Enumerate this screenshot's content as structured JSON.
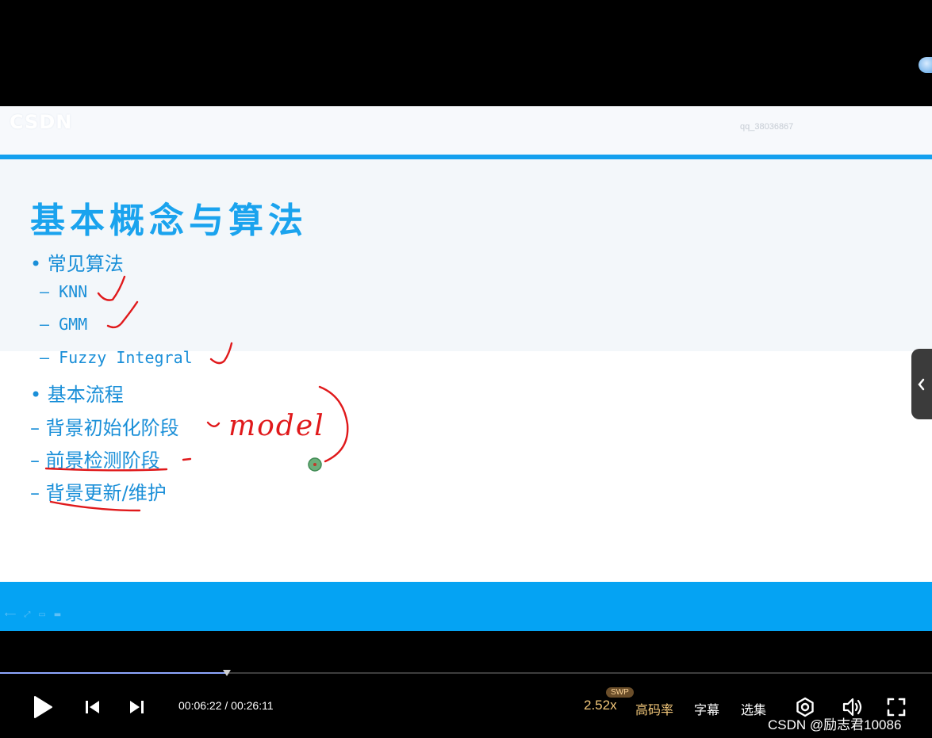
{
  "slide": {
    "logo": "CSDN",
    "user_watermark": "qq_38036867",
    "title": "基本概念与算法",
    "bullets": [
      {
        "marker": "•",
        "text": "常见算法"
      },
      {
        "marker": "–",
        "text": "KNN"
      },
      {
        "marker": "–",
        "text": "GMM"
      },
      {
        "marker": "–",
        "text": "Fuzzy Integral"
      },
      {
        "marker": "•",
        "text": "基本流程"
      },
      {
        "marker": "–",
        "text": "背景初始化阶段"
      },
      {
        "marker": "–",
        "text": "前景检测阶段"
      },
      {
        "marker": "–",
        "text": "背景更新/维护"
      }
    ],
    "handwritten_note": "model"
  },
  "player": {
    "current_time": "00:06:22",
    "total_time": "00:26:11",
    "progress_fraction": 0.243,
    "speed": "2.52x",
    "speed_badge": "SWP",
    "quality": "高码率",
    "subtitle": "字幕",
    "episodes": "选集",
    "icons": [
      "play-icon",
      "previous-icon",
      "next-icon",
      "settings-icon",
      "volume-icon",
      "fullscreen-icon",
      "chevron-left-icon"
    ]
  },
  "watermark": "CSDN @励志君10086",
  "colors": {
    "accent_blue": "#14a0ef",
    "annotation_red": "#e0191b",
    "quality_gold": "#f2c77a"
  }
}
